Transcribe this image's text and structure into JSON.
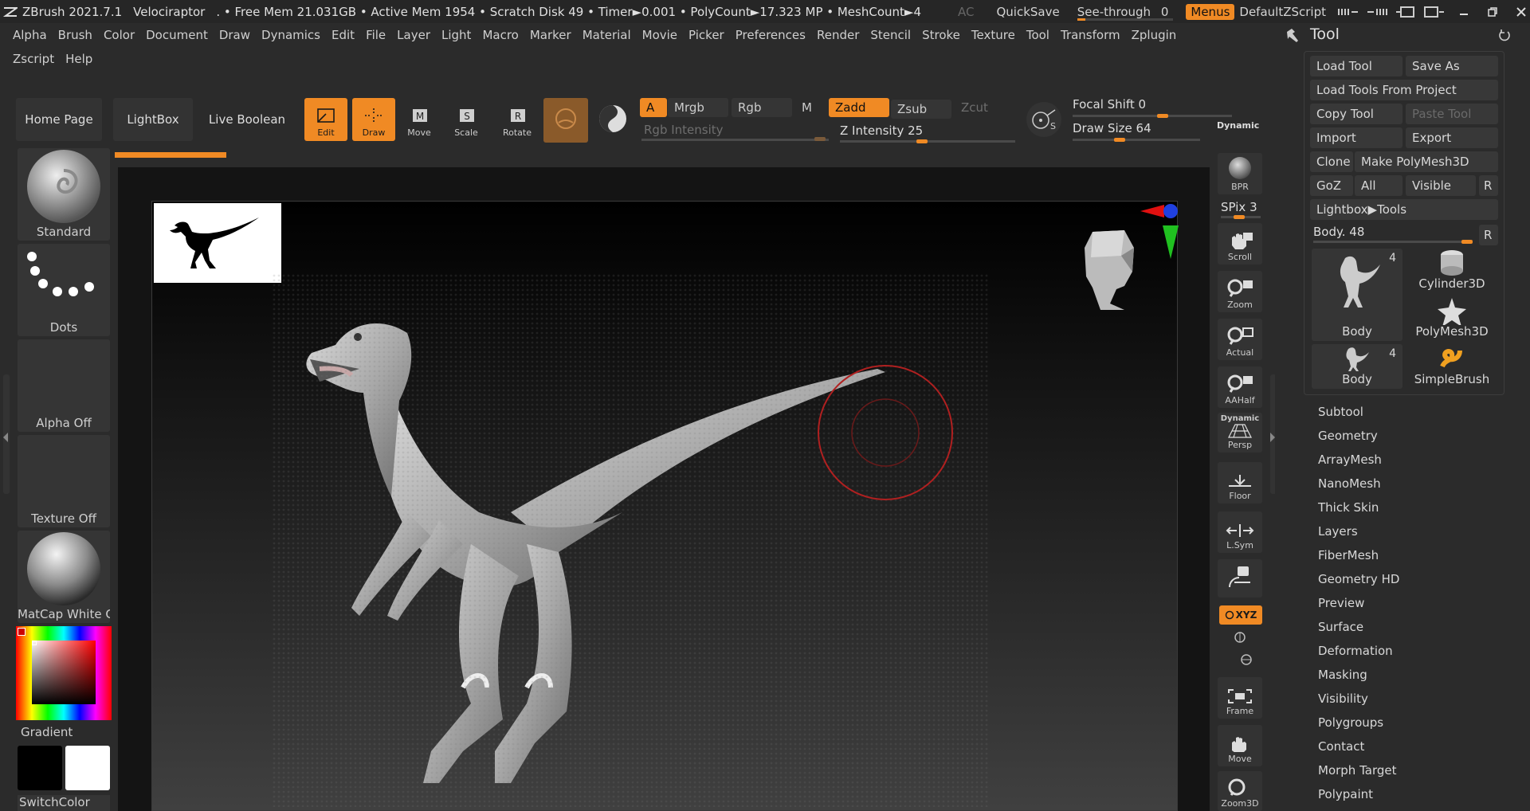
{
  "titlebar": {
    "app": "ZBrush 2021.7.1",
    "doc": "Velociraptor",
    "stats": ". • Free Mem 21.031GB • Active Mem 1954 • Scratch Disk 49 •  Timer►0.001 • PolyCount►17.323 MP  • MeshCount►4",
    "ac": "AC",
    "quicksave": "QuickSave",
    "see_through_label": "See-through",
    "see_through_value": "0",
    "see_through_level": 0.0,
    "menus": "Menus",
    "script": "DefaultZScript"
  },
  "menubar": {
    "row1": [
      "Alpha",
      "Brush",
      "Color",
      "Document",
      "Draw",
      "Dynamics",
      "Edit",
      "File",
      "Layer",
      "Light",
      "Macro",
      "Marker",
      "Material",
      "Movie",
      "Picker",
      "Preferences",
      "Render",
      "Stencil",
      "Stroke",
      "Texture",
      "Tool",
      "Transform",
      "Zplugin"
    ],
    "row2": [
      "Zscript",
      "Help"
    ]
  },
  "toolbar": {
    "home": "Home Page",
    "lightbox": "LightBox",
    "live_boolean": "Live Boolean",
    "edit": "Edit",
    "draw": "Draw",
    "move": "Move",
    "scale": "Scale",
    "rotate": "Rotate",
    "a": "A",
    "mrgb": "Mrgb",
    "rgb": "Rgb",
    "m": "M",
    "zadd": "Zadd",
    "zsub": "Zsub",
    "zcut": "Zcut",
    "rgb_intensity": "Rgb Intensity",
    "z_intensity_label": "Z Intensity",
    "z_intensity": "25",
    "focal_shift_label": "Focal Shift",
    "focal_shift": "0",
    "draw_size_label": "Draw Size",
    "draw_size": "64",
    "dynamic": "Dynamic"
  },
  "left": {
    "brush": "Standard",
    "stroke": "Dots",
    "alpha": "Alpha Off",
    "texture": "Texture Off",
    "material": "MatCap White C",
    "gradient": "Gradient",
    "switchcolor": "SwitchColor"
  },
  "nav": {
    "bpr": "BPR",
    "spix_label": "SPix",
    "spix": "3",
    "scroll": "Scroll",
    "zoom": "Zoom",
    "actual": "Actual",
    "aahalf": "AAHalf",
    "persp_top": "Dynamic",
    "persp": "Persp",
    "floor": "Floor",
    "lsym": "L.Sym",
    "xyz": "XYZ",
    "frame": "Frame",
    "move": "Move",
    "zoom3d": "Zoom3D"
  },
  "tool_panel": {
    "title": "Tool",
    "load_tool": "Load Tool",
    "save_as": "Save As",
    "load_from_project": "Load Tools From Project",
    "copy_tool": "Copy Tool",
    "paste_tool": "Paste Tool",
    "import": "Import",
    "export": "Export",
    "clone": "Clone",
    "make_polymesh": "Make PolyMesh3D",
    "goz": "GoZ",
    "all": "All",
    "visible": "Visible",
    "r": "R",
    "lightbox_tools": "Lightbox▶Tools",
    "body_label": "Body.",
    "body_value": "48",
    "thumbs": [
      {
        "label": "Body",
        "count": "4"
      },
      {
        "label": "Cylinder3D"
      },
      {
        "label": "PolyMesh3D"
      },
      {
        "label": "Body",
        "count": "4"
      },
      {
        "label": "SimpleBrush"
      }
    ],
    "subpalettes": [
      "Subtool",
      "Geometry",
      "ArrayMesh",
      "NanoMesh",
      "Thick Skin",
      "Layers",
      "FiberMesh",
      "Geometry HD",
      "Preview",
      "Surface",
      "Deformation",
      "Masking",
      "Visibility",
      "Polygroups",
      "Contact",
      "Morph Target",
      "Polypaint"
    ]
  },
  "colors": {
    "accent": "#f08a24",
    "bg": "#2b2b2b",
    "panel": "#353535"
  }
}
